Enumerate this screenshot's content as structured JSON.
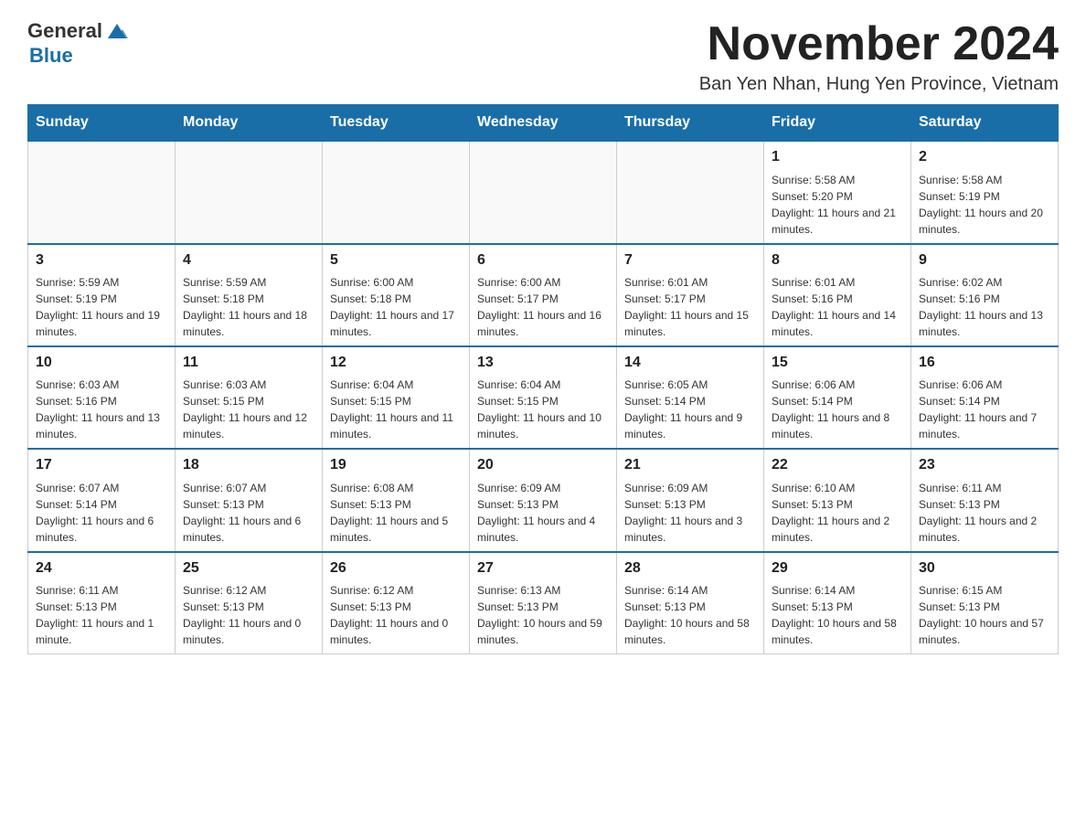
{
  "header": {
    "logo_general": "General",
    "logo_blue": "Blue",
    "title": "November 2024",
    "subtitle": "Ban Yen Nhan, Hung Yen Province, Vietnam"
  },
  "weekdays": [
    "Sunday",
    "Monday",
    "Tuesday",
    "Wednesday",
    "Thursday",
    "Friday",
    "Saturday"
  ],
  "weeks": [
    [
      {
        "day": "",
        "info": ""
      },
      {
        "day": "",
        "info": ""
      },
      {
        "day": "",
        "info": ""
      },
      {
        "day": "",
        "info": ""
      },
      {
        "day": "",
        "info": ""
      },
      {
        "day": "1",
        "info": "Sunrise: 5:58 AM\nSunset: 5:20 PM\nDaylight: 11 hours and 21 minutes."
      },
      {
        "day": "2",
        "info": "Sunrise: 5:58 AM\nSunset: 5:19 PM\nDaylight: 11 hours and 20 minutes."
      }
    ],
    [
      {
        "day": "3",
        "info": "Sunrise: 5:59 AM\nSunset: 5:19 PM\nDaylight: 11 hours and 19 minutes."
      },
      {
        "day": "4",
        "info": "Sunrise: 5:59 AM\nSunset: 5:18 PM\nDaylight: 11 hours and 18 minutes."
      },
      {
        "day": "5",
        "info": "Sunrise: 6:00 AM\nSunset: 5:18 PM\nDaylight: 11 hours and 17 minutes."
      },
      {
        "day": "6",
        "info": "Sunrise: 6:00 AM\nSunset: 5:17 PM\nDaylight: 11 hours and 16 minutes."
      },
      {
        "day": "7",
        "info": "Sunrise: 6:01 AM\nSunset: 5:17 PM\nDaylight: 11 hours and 15 minutes."
      },
      {
        "day": "8",
        "info": "Sunrise: 6:01 AM\nSunset: 5:16 PM\nDaylight: 11 hours and 14 minutes."
      },
      {
        "day": "9",
        "info": "Sunrise: 6:02 AM\nSunset: 5:16 PM\nDaylight: 11 hours and 13 minutes."
      }
    ],
    [
      {
        "day": "10",
        "info": "Sunrise: 6:03 AM\nSunset: 5:16 PM\nDaylight: 11 hours and 13 minutes."
      },
      {
        "day": "11",
        "info": "Sunrise: 6:03 AM\nSunset: 5:15 PM\nDaylight: 11 hours and 12 minutes."
      },
      {
        "day": "12",
        "info": "Sunrise: 6:04 AM\nSunset: 5:15 PM\nDaylight: 11 hours and 11 minutes."
      },
      {
        "day": "13",
        "info": "Sunrise: 6:04 AM\nSunset: 5:15 PM\nDaylight: 11 hours and 10 minutes."
      },
      {
        "day": "14",
        "info": "Sunrise: 6:05 AM\nSunset: 5:14 PM\nDaylight: 11 hours and 9 minutes."
      },
      {
        "day": "15",
        "info": "Sunrise: 6:06 AM\nSunset: 5:14 PM\nDaylight: 11 hours and 8 minutes."
      },
      {
        "day": "16",
        "info": "Sunrise: 6:06 AM\nSunset: 5:14 PM\nDaylight: 11 hours and 7 minutes."
      }
    ],
    [
      {
        "day": "17",
        "info": "Sunrise: 6:07 AM\nSunset: 5:14 PM\nDaylight: 11 hours and 6 minutes."
      },
      {
        "day": "18",
        "info": "Sunrise: 6:07 AM\nSunset: 5:13 PM\nDaylight: 11 hours and 6 minutes."
      },
      {
        "day": "19",
        "info": "Sunrise: 6:08 AM\nSunset: 5:13 PM\nDaylight: 11 hours and 5 minutes."
      },
      {
        "day": "20",
        "info": "Sunrise: 6:09 AM\nSunset: 5:13 PM\nDaylight: 11 hours and 4 minutes."
      },
      {
        "day": "21",
        "info": "Sunrise: 6:09 AM\nSunset: 5:13 PM\nDaylight: 11 hours and 3 minutes."
      },
      {
        "day": "22",
        "info": "Sunrise: 6:10 AM\nSunset: 5:13 PM\nDaylight: 11 hours and 2 minutes."
      },
      {
        "day": "23",
        "info": "Sunrise: 6:11 AM\nSunset: 5:13 PM\nDaylight: 11 hours and 2 minutes."
      }
    ],
    [
      {
        "day": "24",
        "info": "Sunrise: 6:11 AM\nSunset: 5:13 PM\nDaylight: 11 hours and 1 minute."
      },
      {
        "day": "25",
        "info": "Sunrise: 6:12 AM\nSunset: 5:13 PM\nDaylight: 11 hours and 0 minutes."
      },
      {
        "day": "26",
        "info": "Sunrise: 6:12 AM\nSunset: 5:13 PM\nDaylight: 11 hours and 0 minutes."
      },
      {
        "day": "27",
        "info": "Sunrise: 6:13 AM\nSunset: 5:13 PM\nDaylight: 10 hours and 59 minutes."
      },
      {
        "day": "28",
        "info": "Sunrise: 6:14 AM\nSunset: 5:13 PM\nDaylight: 10 hours and 58 minutes."
      },
      {
        "day": "29",
        "info": "Sunrise: 6:14 AM\nSunset: 5:13 PM\nDaylight: 10 hours and 58 minutes."
      },
      {
        "day": "30",
        "info": "Sunrise: 6:15 AM\nSunset: 5:13 PM\nDaylight: 10 hours and 57 minutes."
      }
    ]
  ]
}
